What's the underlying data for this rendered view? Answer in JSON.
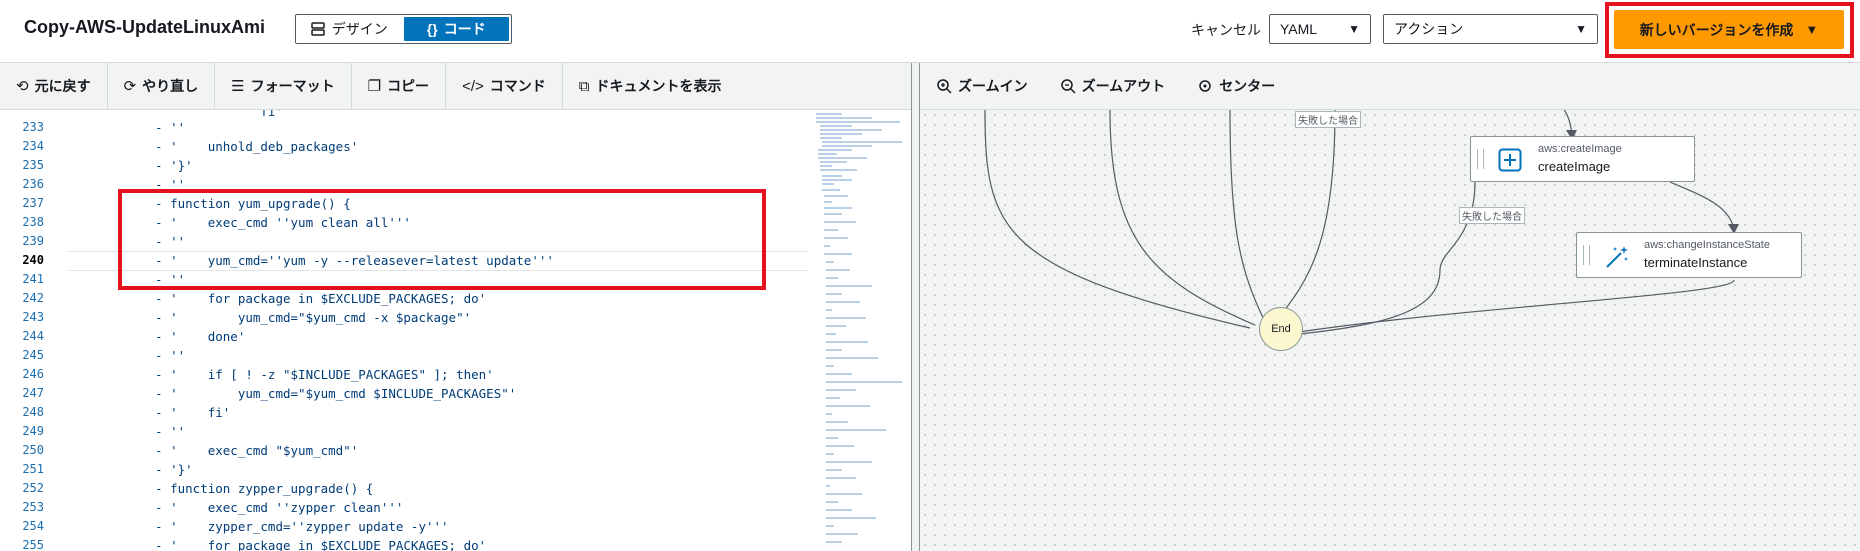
{
  "header": {
    "title": "Copy-AWS-UpdateLinuxAmi",
    "mode_design": "デザイン",
    "mode_code": "コード",
    "cancel": "キャンセル",
    "format_select": "YAML",
    "actions_select": "アクション",
    "create_version": "新しいバージョンを作成"
  },
  "editor_toolbar": {
    "undo": "元に戻す",
    "redo": "やり直し",
    "format": "フォーマット",
    "copy": "コピー",
    "command": "コマンド",
    "show_document": "ドキュメントを表示"
  },
  "canvas_toolbar": {
    "zoom_in": "ズームイン",
    "zoom_out": "ズームアウト",
    "center": "センター"
  },
  "code": {
    "current_line": 240,
    "lines": [
      {
        "n": "",
        "text": "                fi'"
      },
      {
        "n": "233",
        "text": "  - ''"
      },
      {
        "n": "234",
        "text": "  - '    unhold_deb_packages'"
      },
      {
        "n": "235",
        "text": "  - '}'"
      },
      {
        "n": "236",
        "text": "  - ''"
      },
      {
        "n": "237",
        "text": "  - function yum_upgrade() {"
      },
      {
        "n": "238",
        "text": "  - '    exec_cmd ''yum clean all'''"
      },
      {
        "n": "239",
        "text": "  - ''"
      },
      {
        "n": "240",
        "text": "  - '    yum_cmd=''yum -y --releasever=latest update'''"
      },
      {
        "n": "241",
        "text": "  - ''"
      },
      {
        "n": "242",
        "text": "  - '    for package in $EXCLUDE_PACKAGES; do'"
      },
      {
        "n": "243",
        "text": "  - '        yum_cmd=\"$yum_cmd -x $package\"'"
      },
      {
        "n": "244",
        "text": "  - '    done'"
      },
      {
        "n": "245",
        "text": "  - ''"
      },
      {
        "n": "246",
        "text": "  - '    if [ ! -z \"$INCLUDE_PACKAGES\" ]; then'"
      },
      {
        "n": "247",
        "text": "  - '        yum_cmd=\"$yum_cmd $INCLUDE_PACKAGES\"'"
      },
      {
        "n": "248",
        "text": "  - '    fi'"
      },
      {
        "n": "249",
        "text": "  - ''"
      },
      {
        "n": "250",
        "text": "  - '    exec_cmd \"$yum_cmd\"'"
      },
      {
        "n": "251",
        "text": "  - '}'"
      },
      {
        "n": "252",
        "text": "  - function zypper_upgrade() {"
      },
      {
        "n": "253",
        "text": "  - '    exec_cmd ''zypper clean'''"
      },
      {
        "n": "254",
        "text": "  - '    zypper_cmd=''zypper update -y'''"
      },
      {
        "n": "255",
        "text": "  - '    for package in $EXCLUDE_PACKAGES; do'"
      }
    ]
  },
  "canvas": {
    "edge_label_1": "失敗した場合",
    "edge_label_2": "失敗した場合",
    "node_create_image": {
      "type": "aws:createImage",
      "name": "createImage"
    },
    "node_terminate": {
      "type": "aws:changeInstanceState",
      "name": "terminateInstance"
    },
    "end": "End"
  },
  "icons": {
    "design": "layout-icon",
    "code": "braces-icon",
    "undo": "undo-icon",
    "redo": "redo-icon",
    "format": "indent-icon",
    "copy": "copy-icon",
    "command": "code-icon",
    "show_document": "external-link-icon",
    "zoom_in": "zoom-in-icon",
    "zoom_out": "zoom-out-icon",
    "center": "crosshair-icon"
  },
  "colors": {
    "primary": "#ff9900",
    "code_toggle": "#0073bb",
    "highlight": "#e3121e",
    "end_node": "#fcf7ce"
  }
}
